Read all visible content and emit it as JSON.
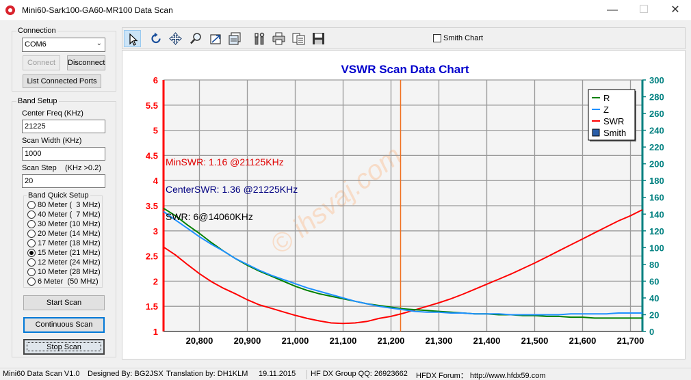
{
  "window": {
    "title": "Mini60-Sark100-GA60-MR100 Data Scan",
    "minimize": "—",
    "maximize": "☐",
    "close": "✕"
  },
  "connection": {
    "title": "Connection",
    "port": "COM6",
    "connect_label": "Connect",
    "disconnect_label": "Disconnect",
    "list_ports_label": "List Connected Ports"
  },
  "band_setup": {
    "title": "Band Setup",
    "center_freq_label": "Center Freq  (KHz)",
    "center_freq_value": "21225",
    "scan_width_label": "Scan Width   (KHz)",
    "scan_width_value": "1000",
    "scan_step_label": "Scan Step",
    "scan_step_hint": "(KHz >0.2)",
    "scan_step_value": "20",
    "quick_title": "Band Quick Setup",
    "bands": [
      {
        "label": "80 Meter (  3 MHz)",
        "checked": false
      },
      {
        "label": "40 Meter (  7 MHz)",
        "checked": false
      },
      {
        "label": "30 Meter (10 MHz)",
        "checked": false
      },
      {
        "label": "20 Meter (14 MHz)",
        "checked": false
      },
      {
        "label": "17 Meter (18 MHz)",
        "checked": false
      },
      {
        "label": "15 Meter (21 MHz)",
        "checked": true
      },
      {
        "label": "12 Meter (24 MHz)",
        "checked": false
      },
      {
        "label": "10 Meter (28 MHz)",
        "checked": false
      },
      {
        "label": "6 Meter  (50 MHz)",
        "checked": false
      }
    ]
  },
  "actions": {
    "start_scan": "Start Scan",
    "continuous_scan": "Continuous Scan",
    "stop_scan": "Stop Scan"
  },
  "toolbar": {
    "tools": [
      "pointer-icon",
      "rotate-icon",
      "move-icon",
      "zoom-icon",
      "zoom-area-icon",
      "save-chart-icon",
      "settings-icon",
      "print-icon",
      "copy-icon",
      "save-icon"
    ],
    "smith_chart_label": "Smith Chart",
    "smith_chart_checked": false
  },
  "statusbar": {
    "version": "Mini60 Data Scan V1.0",
    "designed_by": "Designed By: BG2JSX",
    "translation": "Translation by: DH1KLM",
    "date": "19.11.2015",
    "group": "HF DX Group QQ: 26923662",
    "forum": "HFDX Forum：  http://www.hfdx59.com"
  },
  "chart_data": {
    "type": "line",
    "title": "VSWR Scan Data Chart",
    "watermark": "© ihsvaj.com",
    "x_ticks": [
      "20,800",
      "20,900",
      "21,000",
      "21,100",
      "21,200",
      "21,300",
      "21,400",
      "21,500",
      "21,600",
      "21,700"
    ],
    "xlim": [
      20725,
      21725
    ],
    "y_left_ticks": [
      "1",
      "1.5",
      "2",
      "2.5",
      "3",
      "3.5",
      "4",
      "4.5",
      "5",
      "5.5",
      "6"
    ],
    "ylim_left": [
      1,
      6
    ],
    "y_right_ticks": [
      "0",
      "20",
      "40",
      "60",
      "80",
      "100",
      "120",
      "140",
      "160",
      "180",
      "200",
      "220",
      "240",
      "260",
      "280",
      "300"
    ],
    "ylim_right": [
      0,
      300
    ],
    "grid": true,
    "legend_position": "top-right",
    "legend": [
      {
        "name": "R",
        "color": "#008000",
        "marker": "line"
      },
      {
        "name": "Z",
        "color": "#1e90ff",
        "marker": "line"
      },
      {
        "name": "SWR",
        "color": "#ff0000",
        "marker": "line"
      },
      {
        "name": "Smith",
        "color": "#2a5ea8",
        "marker": "box"
      }
    ],
    "annotations": [
      {
        "text": "MinSWR: 1.16 @21125KHz",
        "color": "#e00000"
      },
      {
        "text": "CenterSWR: 1.36 @21225KHz",
        "color": "#000080"
      },
      {
        "text": "SWR: 6@14060KHz",
        "color": "#000000"
      }
    ],
    "center_marker_x": 21220,
    "left_axis_color": "#ff0000",
    "right_axis_color": "#008080",
    "title_color": "#0000cc",
    "series": [
      {
        "name": "SWR",
        "axis": "left",
        "color": "#ff0000",
        "x": [
          20725,
          20750,
          20775,
          20800,
          20825,
          20850,
          20875,
          20900,
          20925,
          20950,
          20975,
          21000,
          21025,
          21050,
          21075,
          21100,
          21125,
          21150,
          21175,
          21200,
          21225,
          21250,
          21275,
          21300,
          21325,
          21350,
          21375,
          21400,
          21425,
          21450,
          21475,
          21500,
          21525,
          21550,
          21575,
          21600,
          21625,
          21650,
          21675,
          21700,
          21725
        ],
        "y": [
          2.68,
          2.52,
          2.33,
          2.15,
          1.99,
          1.86,
          1.75,
          1.63,
          1.53,
          1.46,
          1.39,
          1.32,
          1.26,
          1.21,
          1.17,
          1.16,
          1.17,
          1.2,
          1.26,
          1.3,
          1.36,
          1.43,
          1.5,
          1.57,
          1.65,
          1.74,
          1.84,
          1.94,
          2.04,
          2.14,
          2.25,
          2.36,
          2.48,
          2.6,
          2.72,
          2.84,
          2.96,
          3.08,
          3.2,
          3.3,
          3.42
        ]
      },
      {
        "name": "R",
        "axis": "right",
        "color": "#008000",
        "x": [
          20725,
          20750,
          20775,
          20800,
          20825,
          20850,
          20875,
          20900,
          20925,
          20950,
          20975,
          21000,
          21025,
          21050,
          21075,
          21100,
          21125,
          21150,
          21175,
          21200,
          21225,
          21250,
          21275,
          21300,
          21325,
          21350,
          21375,
          21400,
          21425,
          21450,
          21475,
          21500,
          21525,
          21550,
          21575,
          21600,
          21625,
          21650,
          21675,
          21700,
          21725
        ],
        "y": [
          147,
          138,
          127,
          117,
          106,
          96,
          87,
          79,
          72,
          66,
          60,
          54,
          49,
          45,
          42,
          39,
          36,
          33,
          31,
          29,
          27,
          26,
          25,
          24,
          23,
          22,
          21,
          21,
          20,
          20,
          19,
          19,
          18,
          18,
          17,
          17,
          16,
          16,
          16,
          16,
          16
        ]
      },
      {
        "name": "Z",
        "axis": "right",
        "color": "#1e90ff",
        "x": [
          20725,
          20750,
          20775,
          20800,
          20825,
          20850,
          20875,
          20900,
          20925,
          20950,
          20975,
          21000,
          21025,
          21050,
          21075,
          21100,
          21125,
          21150,
          21175,
          21200,
          21225,
          21250,
          21275,
          21300,
          21325,
          21350,
          21375,
          21400,
          21425,
          21450,
          21475,
          21500,
          21525,
          21550,
          21575,
          21600,
          21625,
          21650,
          21675,
          21700,
          21725
        ],
        "y": [
          143,
          133,
          123,
          113,
          104,
          96,
          87,
          80,
          73,
          67,
          62,
          57,
          52,
          48,
          44,
          40,
          36,
          33,
          30,
          28,
          26,
          24,
          23,
          23,
          22,
          22,
          21,
          21,
          21,
          20,
          20,
          20,
          20,
          20,
          21,
          21,
          21,
          21,
          22,
          22,
          22
        ]
      }
    ]
  }
}
